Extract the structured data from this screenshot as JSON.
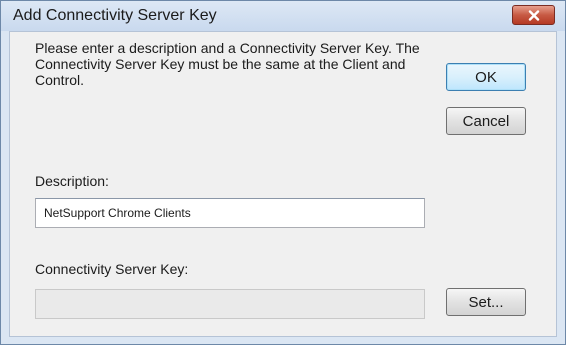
{
  "window": {
    "title": "Add Connectivity Server Key",
    "close_icon": "close-x-icon"
  },
  "instructions": "Please enter a description and a Connectivity Server Key. The Connectivity Server Key must be the same at the Client and Control.",
  "buttons": {
    "ok_label": "OK",
    "cancel_label": "Cancel",
    "set_label": "Set..."
  },
  "description": {
    "label": "Description:",
    "value": "NetSupport Chrome Clients"
  },
  "server_key": {
    "label": "Connectivity Server Key:",
    "value": ""
  },
  "colors": {
    "close_button": "#c75a44",
    "dialog_background": "#f0f0f0",
    "title_background": "#c9d9ee"
  }
}
